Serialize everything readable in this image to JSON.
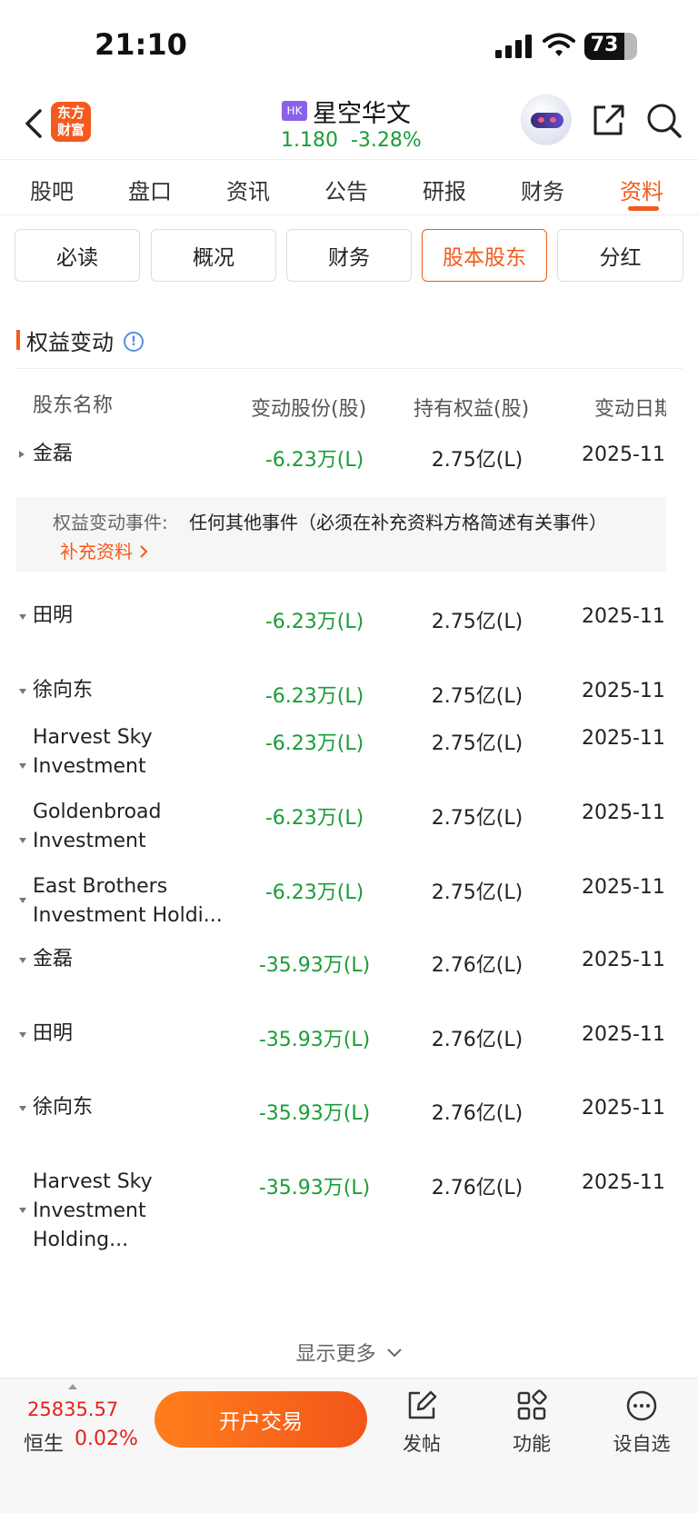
{
  "status_bar": {
    "time": "21:10",
    "battery": "73"
  },
  "header": {
    "logo_line1": "东方",
    "logo_line2": "财富",
    "badge": "HK",
    "stock_name": "星空华文",
    "price": "1.180",
    "change_pct": "-3.28%"
  },
  "main_tabs": [
    "股吧",
    "盘口",
    "资讯",
    "公告",
    "研报",
    "财务",
    "资料"
  ],
  "main_tab_active": "资料",
  "sub_tabs": [
    "必读",
    "概况",
    "财务",
    "股本股东",
    "分红"
  ],
  "sub_tab_active": "股本股东",
  "section": {
    "title": "权益变动",
    "info_glyph": "!"
  },
  "table": {
    "headers": [
      "股东名称",
      "变动股份(股)",
      "持有权益(股)",
      "变动日期"
    ],
    "rows": [
      {
        "name": "金磊",
        "change": "-6.23万(L)",
        "hold": "2.75亿(L)",
        "date": "2025-11-",
        "expanded": true
      },
      {
        "name": "田明",
        "change": "-6.23万(L)",
        "hold": "2.75亿(L)",
        "date": "2025-11-"
      },
      {
        "name": "徐向东",
        "change": "-6.23万(L)",
        "hold": "2.75亿(L)",
        "date": "2025-11-"
      },
      {
        "name": "Harvest Sky Investment",
        "change": "-6.23万(L)",
        "hold": "2.75亿(L)",
        "date": "2025-11-"
      },
      {
        "name": "Goldenbroad Investment",
        "change": "-6.23万(L)",
        "hold": "2.75亿(L)",
        "date": "2025-11-"
      },
      {
        "name": "East Brothers Investment Holdi...",
        "change": "-6.23万(L)",
        "hold": "2.75亿(L)",
        "date": "2025-11-"
      },
      {
        "name": "金磊",
        "change": "-35.93万(L)",
        "hold": "2.76亿(L)",
        "date": "2025-11-"
      },
      {
        "name": "田明",
        "change": "-35.93万(L)",
        "hold": "2.76亿(L)",
        "date": "2025-11-"
      },
      {
        "name": "徐向东",
        "change": "-35.93万(L)",
        "hold": "2.76亿(L)",
        "date": "2025-11-"
      },
      {
        "name": "Harvest Sky Investment Holding...",
        "change": "-35.93万(L)",
        "hold": "2.76亿(L)",
        "date": "2025-11-"
      }
    ],
    "event": {
      "label": "权益变动事件:",
      "text": "任何其他事件（必须在补充资料方格简述有关事件）",
      "link": "补充资料"
    }
  },
  "show_more": "显示更多",
  "bottom_bar": {
    "index_value": "25835.57",
    "index_name": "恒生",
    "index_pct": "0.02%",
    "trade_button": "开户交易",
    "post": "发帖",
    "functions": "功能",
    "watchlist": "设自选"
  },
  "colors": {
    "accent": "#f45a1a",
    "down_green": "#1a9d36",
    "up_red": "#e2231a",
    "hk_badge": "#8a62e8"
  }
}
